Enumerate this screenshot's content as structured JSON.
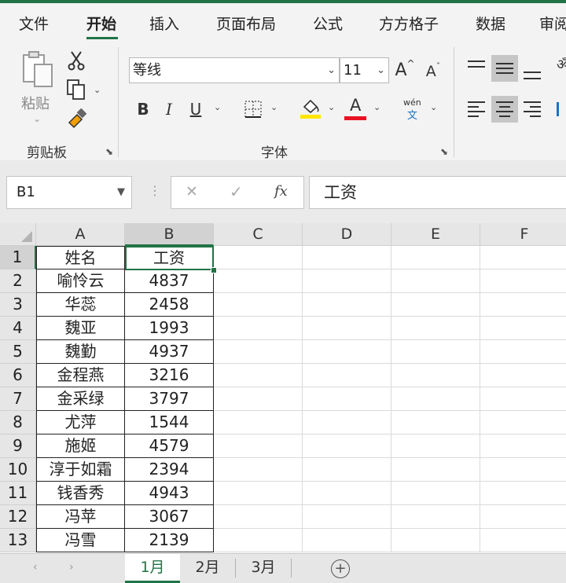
{
  "ribbon_tabs": [
    "文件",
    "开始",
    "插入",
    "页面布局",
    "公式",
    "方方格子",
    "数据",
    "审阅"
  ],
  "active_tab": "开始",
  "clipboard": {
    "paste_label": "粘贴",
    "group_label": "剪贴板"
  },
  "font": {
    "name": "等线",
    "size": "11",
    "group_label": "字体",
    "grow_label": "A",
    "shrink_label": "A",
    "bold_label": "B",
    "italic_label": "I",
    "underline_label": "U",
    "phonetic_label": "wén"
  },
  "colors": {
    "accent": "#217346",
    "highlight": "#ffe600",
    "font_color": "#e81123"
  },
  "formula_bar": {
    "name_box": "B1",
    "fx_label": "fx",
    "cancel_label": "✕",
    "enter_label": "✓",
    "value": "工资"
  },
  "columns": [
    "A",
    "B",
    "C",
    "D",
    "E",
    "F"
  ],
  "selected_column": "B",
  "rows": [
    {
      "num": "1",
      "a": "姓名",
      "b": "工资"
    },
    {
      "num": "2",
      "a": "喻怜云",
      "b": "4837"
    },
    {
      "num": "3",
      "a": "华蕊",
      "b": "2458"
    },
    {
      "num": "4",
      "a": "魏亚",
      "b": "1993"
    },
    {
      "num": "5",
      "a": "魏勤",
      "b": "4937"
    },
    {
      "num": "6",
      "a": "金程燕",
      "b": "3216"
    },
    {
      "num": "7",
      "a": "金采绿",
      "b": "3797"
    },
    {
      "num": "8",
      "a": "尤萍",
      "b": "1544"
    },
    {
      "num": "9",
      "a": "施姬",
      "b": "4579"
    },
    {
      "num": "10",
      "a": "淳于如霜",
      "b": "2394"
    },
    {
      "num": "11",
      "a": "钱香秀",
      "b": "4943"
    },
    {
      "num": "12",
      "a": "冯苹",
      "b": "3067"
    },
    {
      "num": "13",
      "a": "冯雪",
      "b": "2139"
    }
  ],
  "selected_row": "1",
  "sheets": [
    "1月",
    "2月",
    "3月"
  ],
  "active_sheet": "1月"
}
